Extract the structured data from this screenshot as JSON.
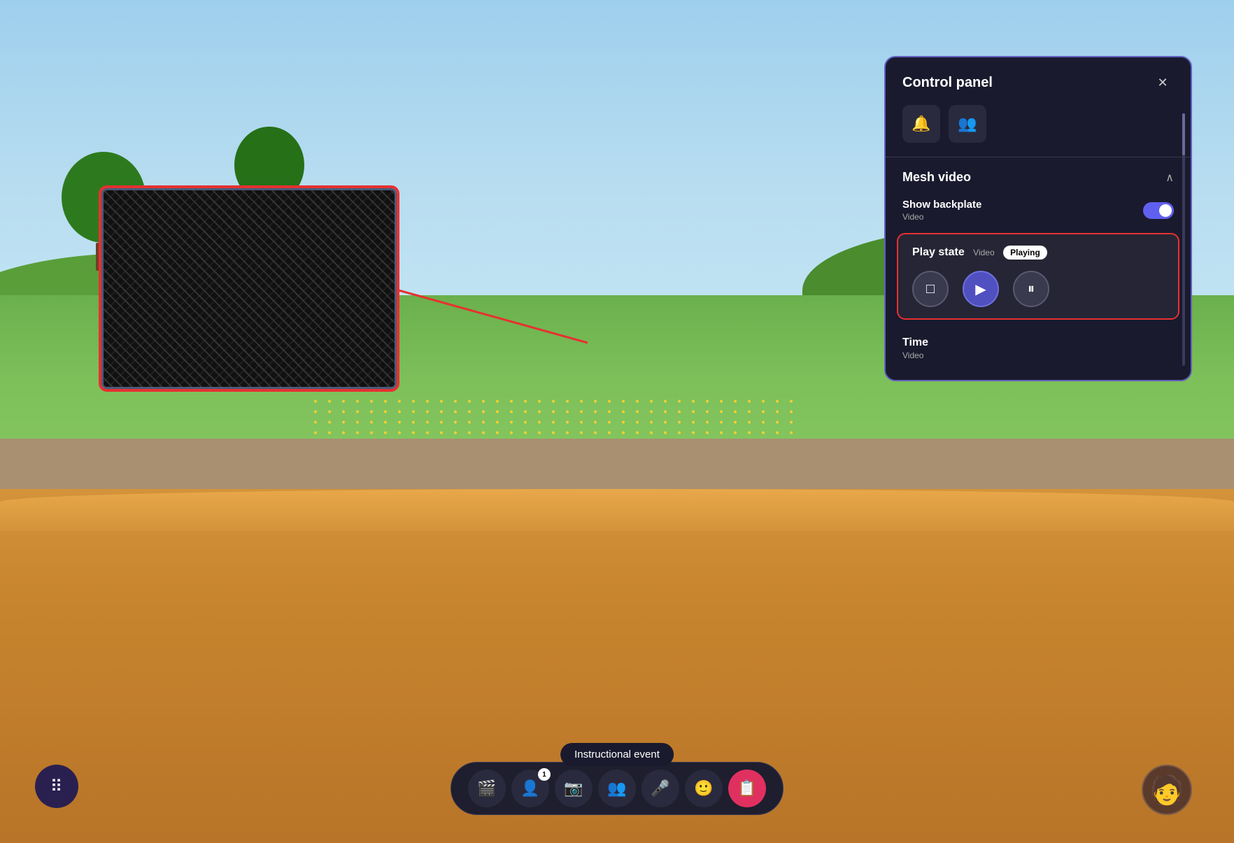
{
  "scene": {
    "background": "virtual meeting room with nature scene"
  },
  "control_panel": {
    "title": "Control panel",
    "close_label": "✕",
    "icons": [
      {
        "name": "bell-icon",
        "symbol": "🔔"
      },
      {
        "name": "people-settings-icon",
        "symbol": "👥"
      }
    ],
    "mesh_video_section": {
      "title": "Mesh video",
      "chevron": "∧",
      "show_backplate": {
        "label": "Show backplate",
        "sublabel": "Video",
        "enabled": true
      },
      "play_state": {
        "label": "Play state",
        "sublabel": "Video",
        "status_badge": "Playing",
        "controls": {
          "stop_symbol": "□",
          "play_symbol": "▶",
          "pause_symbol": "⏸"
        }
      },
      "time": {
        "label": "Time",
        "sublabel": "Video"
      }
    }
  },
  "toolbar": {
    "items": [
      {
        "name": "scene-icon",
        "symbol": "🎬",
        "label": "Scene"
      },
      {
        "name": "participants-icon",
        "symbol": "👤",
        "label": "Participants",
        "badge": "1"
      },
      {
        "name": "camera-icon",
        "symbol": "📷",
        "label": "Camera"
      },
      {
        "name": "people-icon",
        "symbol": "👥",
        "label": "People"
      },
      {
        "name": "mic-icon",
        "symbol": "🎤",
        "label": "Microphone"
      },
      {
        "name": "emoji-icon",
        "symbol": "🙂",
        "label": "Emoji"
      },
      {
        "name": "share-icon",
        "symbol": "📋",
        "label": "Share",
        "active": true
      }
    ]
  },
  "grid_button": {
    "symbol": "⠿",
    "label": "Grid"
  },
  "tooltip": {
    "text": "Instructional event"
  },
  "video_screen": {
    "label": "Mesh video screen"
  }
}
